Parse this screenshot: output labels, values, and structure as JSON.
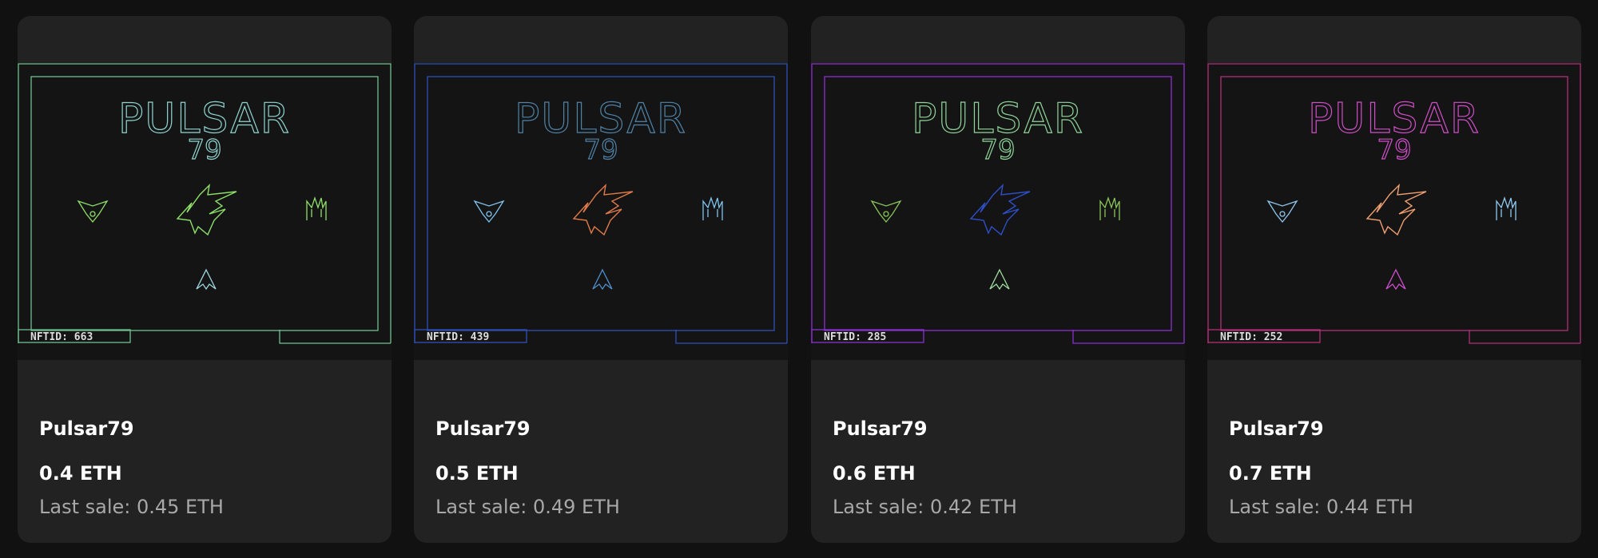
{
  "cards": [
    {
      "name": "Pulsar79",
      "price": "0.4 ETH",
      "last_sale": "Last sale: 0.45 ETH",
      "logo_text": "PULSAR",
      "logo_sub": "79",
      "nft_tag": "NFTID: 663",
      "colors": {
        "frame": "#6fbf8f",
        "logo": "#8fd4cf",
        "left_ship": "#8fe06a",
        "center": "#8fe06a",
        "right_ship": "#8fe06a",
        "player": "#9fd8e0"
      }
    },
    {
      "name": "Pulsar79",
      "price": "0.5 ETH",
      "last_sale": "Last sale: 0.49 ETH",
      "logo_text": "PULSAR",
      "logo_sub": "79",
      "nft_tag": "NFTID: 439",
      "colors": {
        "frame": "#2f4fb8",
        "logo": "#4f83a8",
        "left_ship": "#7fc3ef",
        "center": "#e07a4a",
        "right_ship": "#7fc3ef",
        "player": "#4f8fc8"
      }
    },
    {
      "name": "Pulsar79",
      "price": "0.6 ETH",
      "last_sale": "Last sale: 0.42 ETH",
      "logo_text": "PULSAR",
      "logo_sub": "79",
      "nft_tag": "NFTID: 285",
      "colors": {
        "frame": "#8a2fd0",
        "logo": "#8fd49a",
        "left_ship": "#8ac45a",
        "center": "#2f4fc8",
        "right_ship": "#8ac45a",
        "player": "#9fe0a0"
      }
    },
    {
      "name": "Pulsar79",
      "price": "0.7 ETH",
      "last_sale": "Last sale: 0.44 ETH",
      "logo_text": "PULSAR",
      "logo_sub": "79",
      "nft_tag": "NFTID: 252",
      "colors": {
        "frame": "#b02f78",
        "logo": "#d04fc8",
        "left_ship": "#8fc8ef",
        "center": "#f0a070",
        "right_ship": "#8fc8ef",
        "player": "#d04fd0"
      }
    }
  ]
}
